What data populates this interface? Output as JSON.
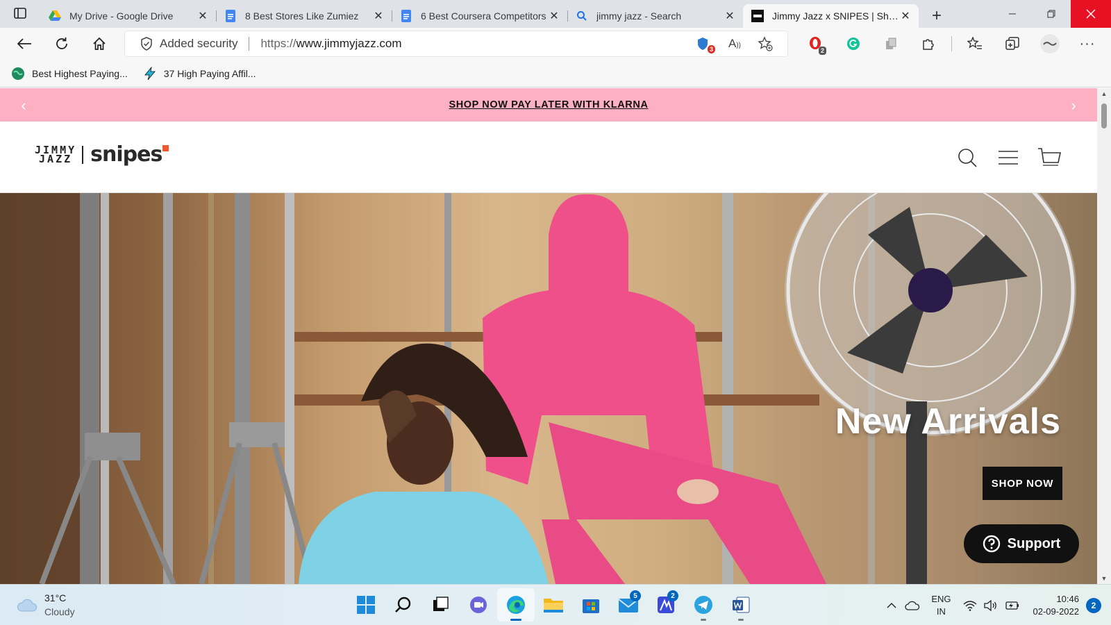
{
  "browser": {
    "tabs": [
      {
        "title": "My Drive - Google Drive",
        "icon": "google-drive-icon"
      },
      {
        "title": "8 Best Stores Like Zumiez",
        "icon": "google-docs-icon"
      },
      {
        "title": "6 Best Coursera Competitors",
        "icon": "google-docs-icon"
      },
      {
        "title": "jimmy jazz - Search",
        "icon": "search-icon"
      },
      {
        "title": "Jimmy Jazz x SNIPES | Shop",
        "icon": "jimmyjazz-favicon",
        "active": true
      }
    ],
    "new_tab_label": "+",
    "address": {
      "security_label": "Added security",
      "url_proto": "https://",
      "url_host": "www.jimmyjazz.com"
    },
    "extension_badges": {
      "tracker_count": "3",
      "opera_count": "2"
    },
    "favorites": [
      {
        "label": "Best Highest Paying...",
        "icon": "globe-favicon"
      },
      {
        "label": "37 High Paying Affil...",
        "icon": "lightning-favicon"
      }
    ]
  },
  "site": {
    "promo": {
      "text": "SHOP NOW PAY LATER WITH KLARNA",
      "prev": "‹",
      "next": "›"
    },
    "logo": {
      "line1": "JIMMY",
      "line2": "JAZZ",
      "brand": "snipes"
    },
    "hero": {
      "headline": "New Arrivals",
      "cta": "SHOP NOW"
    },
    "support_label": "Support",
    "colors": {
      "promo_bg": "#fdb0c4",
      "hoodie_pink": "#f0508a",
      "hoodie_blue": "#7fd2e6",
      "cta_bg": "#111111",
      "logo_accent": "#f0582f"
    }
  },
  "taskbar": {
    "weather": {
      "temp": "31°C",
      "condition": "Cloudy"
    },
    "apps": [
      {
        "name": "start",
        "icon": "windows-icon"
      },
      {
        "name": "search",
        "icon": "search-icon"
      },
      {
        "name": "task-view",
        "icon": "task-view-icon"
      },
      {
        "name": "teams-chat",
        "icon": "chat-icon"
      },
      {
        "name": "edge",
        "icon": "edge-icon",
        "active": true
      },
      {
        "name": "file-explorer",
        "icon": "folder-icon"
      },
      {
        "name": "store",
        "icon": "store-icon"
      },
      {
        "name": "mail",
        "icon": "mail-icon",
        "badge": "5"
      },
      {
        "name": "photo-app",
        "icon": "app-icon",
        "badge": "2"
      },
      {
        "name": "telegram",
        "icon": "telegram-icon"
      },
      {
        "name": "word",
        "icon": "word-icon"
      }
    ],
    "language": {
      "line1": "ENG",
      "line2": "IN"
    },
    "clock": {
      "time": "10:46",
      "date": "02-09-2022"
    },
    "notifications": "2"
  }
}
